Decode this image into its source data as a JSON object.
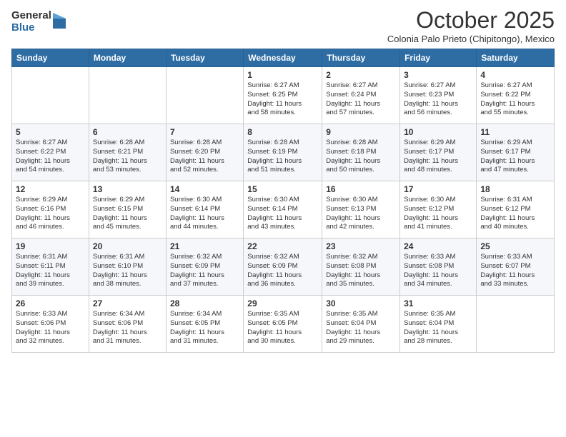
{
  "logo": {
    "general": "General",
    "blue": "Blue"
  },
  "header": {
    "month": "October 2025",
    "subtitle": "Colonia Palo Prieto (Chipitongo), Mexico"
  },
  "weekdays": [
    "Sunday",
    "Monday",
    "Tuesday",
    "Wednesday",
    "Thursday",
    "Friday",
    "Saturday"
  ],
  "weeks": [
    [
      {
        "day": "",
        "info": ""
      },
      {
        "day": "",
        "info": ""
      },
      {
        "day": "",
        "info": ""
      },
      {
        "day": "1",
        "info": "Sunrise: 6:27 AM\nSunset: 6:25 PM\nDaylight: 11 hours\nand 58 minutes."
      },
      {
        "day": "2",
        "info": "Sunrise: 6:27 AM\nSunset: 6:24 PM\nDaylight: 11 hours\nand 57 minutes."
      },
      {
        "day": "3",
        "info": "Sunrise: 6:27 AM\nSunset: 6:23 PM\nDaylight: 11 hours\nand 56 minutes."
      },
      {
        "day": "4",
        "info": "Sunrise: 6:27 AM\nSunset: 6:22 PM\nDaylight: 11 hours\nand 55 minutes."
      }
    ],
    [
      {
        "day": "5",
        "info": "Sunrise: 6:27 AM\nSunset: 6:22 PM\nDaylight: 11 hours\nand 54 minutes."
      },
      {
        "day": "6",
        "info": "Sunrise: 6:28 AM\nSunset: 6:21 PM\nDaylight: 11 hours\nand 53 minutes."
      },
      {
        "day": "7",
        "info": "Sunrise: 6:28 AM\nSunset: 6:20 PM\nDaylight: 11 hours\nand 52 minutes."
      },
      {
        "day": "8",
        "info": "Sunrise: 6:28 AM\nSunset: 6:19 PM\nDaylight: 11 hours\nand 51 minutes."
      },
      {
        "day": "9",
        "info": "Sunrise: 6:28 AM\nSunset: 6:18 PM\nDaylight: 11 hours\nand 50 minutes."
      },
      {
        "day": "10",
        "info": "Sunrise: 6:29 AM\nSunset: 6:17 PM\nDaylight: 11 hours\nand 48 minutes."
      },
      {
        "day": "11",
        "info": "Sunrise: 6:29 AM\nSunset: 6:17 PM\nDaylight: 11 hours\nand 47 minutes."
      }
    ],
    [
      {
        "day": "12",
        "info": "Sunrise: 6:29 AM\nSunset: 6:16 PM\nDaylight: 11 hours\nand 46 minutes."
      },
      {
        "day": "13",
        "info": "Sunrise: 6:29 AM\nSunset: 6:15 PM\nDaylight: 11 hours\nand 45 minutes."
      },
      {
        "day": "14",
        "info": "Sunrise: 6:30 AM\nSunset: 6:14 PM\nDaylight: 11 hours\nand 44 minutes."
      },
      {
        "day": "15",
        "info": "Sunrise: 6:30 AM\nSunset: 6:14 PM\nDaylight: 11 hours\nand 43 minutes."
      },
      {
        "day": "16",
        "info": "Sunrise: 6:30 AM\nSunset: 6:13 PM\nDaylight: 11 hours\nand 42 minutes."
      },
      {
        "day": "17",
        "info": "Sunrise: 6:30 AM\nSunset: 6:12 PM\nDaylight: 11 hours\nand 41 minutes."
      },
      {
        "day": "18",
        "info": "Sunrise: 6:31 AM\nSunset: 6:12 PM\nDaylight: 11 hours\nand 40 minutes."
      }
    ],
    [
      {
        "day": "19",
        "info": "Sunrise: 6:31 AM\nSunset: 6:11 PM\nDaylight: 11 hours\nand 39 minutes."
      },
      {
        "day": "20",
        "info": "Sunrise: 6:31 AM\nSunset: 6:10 PM\nDaylight: 11 hours\nand 38 minutes."
      },
      {
        "day": "21",
        "info": "Sunrise: 6:32 AM\nSunset: 6:09 PM\nDaylight: 11 hours\nand 37 minutes."
      },
      {
        "day": "22",
        "info": "Sunrise: 6:32 AM\nSunset: 6:09 PM\nDaylight: 11 hours\nand 36 minutes."
      },
      {
        "day": "23",
        "info": "Sunrise: 6:32 AM\nSunset: 6:08 PM\nDaylight: 11 hours\nand 35 minutes."
      },
      {
        "day": "24",
        "info": "Sunrise: 6:33 AM\nSunset: 6:08 PM\nDaylight: 11 hours\nand 34 minutes."
      },
      {
        "day": "25",
        "info": "Sunrise: 6:33 AM\nSunset: 6:07 PM\nDaylight: 11 hours\nand 33 minutes."
      }
    ],
    [
      {
        "day": "26",
        "info": "Sunrise: 6:33 AM\nSunset: 6:06 PM\nDaylight: 11 hours\nand 32 minutes."
      },
      {
        "day": "27",
        "info": "Sunrise: 6:34 AM\nSunset: 6:06 PM\nDaylight: 11 hours\nand 31 minutes."
      },
      {
        "day": "28",
        "info": "Sunrise: 6:34 AM\nSunset: 6:05 PM\nDaylight: 11 hours\nand 31 minutes."
      },
      {
        "day": "29",
        "info": "Sunrise: 6:35 AM\nSunset: 6:05 PM\nDaylight: 11 hours\nand 30 minutes."
      },
      {
        "day": "30",
        "info": "Sunrise: 6:35 AM\nSunset: 6:04 PM\nDaylight: 11 hours\nand 29 minutes."
      },
      {
        "day": "31",
        "info": "Sunrise: 6:35 AM\nSunset: 6:04 PM\nDaylight: 11 hours\nand 28 minutes."
      },
      {
        "day": "",
        "info": ""
      }
    ]
  ]
}
